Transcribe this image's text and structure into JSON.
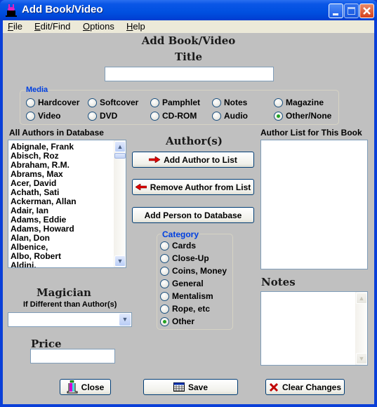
{
  "window": {
    "title": "Add Book/Video",
    "controls": {
      "minimize": "minimize-icon",
      "maximize": "maximize-icon",
      "close": "close-icon"
    }
  },
  "menu": {
    "items": [
      {
        "label": "File",
        "mnemonic": "F"
      },
      {
        "label": "Edit/Find",
        "mnemonic": "E"
      },
      {
        "label": "Options",
        "mnemonic": "O"
      },
      {
        "label": "Help",
        "mnemonic": "H"
      }
    ]
  },
  "form": {
    "heading": "Add Book/Video",
    "title_label": "Title",
    "title_value": "",
    "media": {
      "label": "Media",
      "options": [
        "Hardcover",
        "Softcover",
        "Pamphlet",
        "Notes",
        "Magazine",
        "Video",
        "DVD",
        "CD-ROM",
        "Audio",
        "Other/None"
      ],
      "selected": "Other/None"
    },
    "all_authors": {
      "label": "All Authors in Database",
      "items": [
        "Abignale, Frank",
        "Abisch, Roz",
        "Abraham, R.M.",
        "Abrams, Max",
        "Acer, David",
        "Achath, Sati",
        "Ackerman, Allan",
        "Adair, Ian",
        "Adams, Eddie",
        "Adams, Howard",
        "Alan, Don",
        "Albenice,",
        "Albo, Robert",
        "Aldini,"
      ]
    },
    "authors_heading": "Author(s)",
    "buttons": {
      "add_author": "Add Author to List",
      "remove_author": "Remove Author from List",
      "add_person": "Add Person to Database"
    },
    "author_list_label": "Author List for This Book",
    "author_list_items": [],
    "category": {
      "label": "Category",
      "options": [
        "Cards",
        "Close-Up",
        "Coins, Money",
        "General",
        "Mentalism",
        "Rope, etc",
        "Other"
      ],
      "selected": "Other"
    },
    "magician": {
      "label": "Magician",
      "sublabel": "If Different than Author(s)",
      "value": ""
    },
    "price": {
      "label": "Price",
      "value": ""
    },
    "notes": {
      "label": "Notes",
      "value": ""
    }
  },
  "footer": {
    "close": "Close",
    "save": "Save",
    "clear": "Clear Changes"
  },
  "colors": {
    "titlebar": "#0050e0",
    "group_label": "#0040e0",
    "radio_checked": "#21a121",
    "background": "#c0c0c0"
  }
}
